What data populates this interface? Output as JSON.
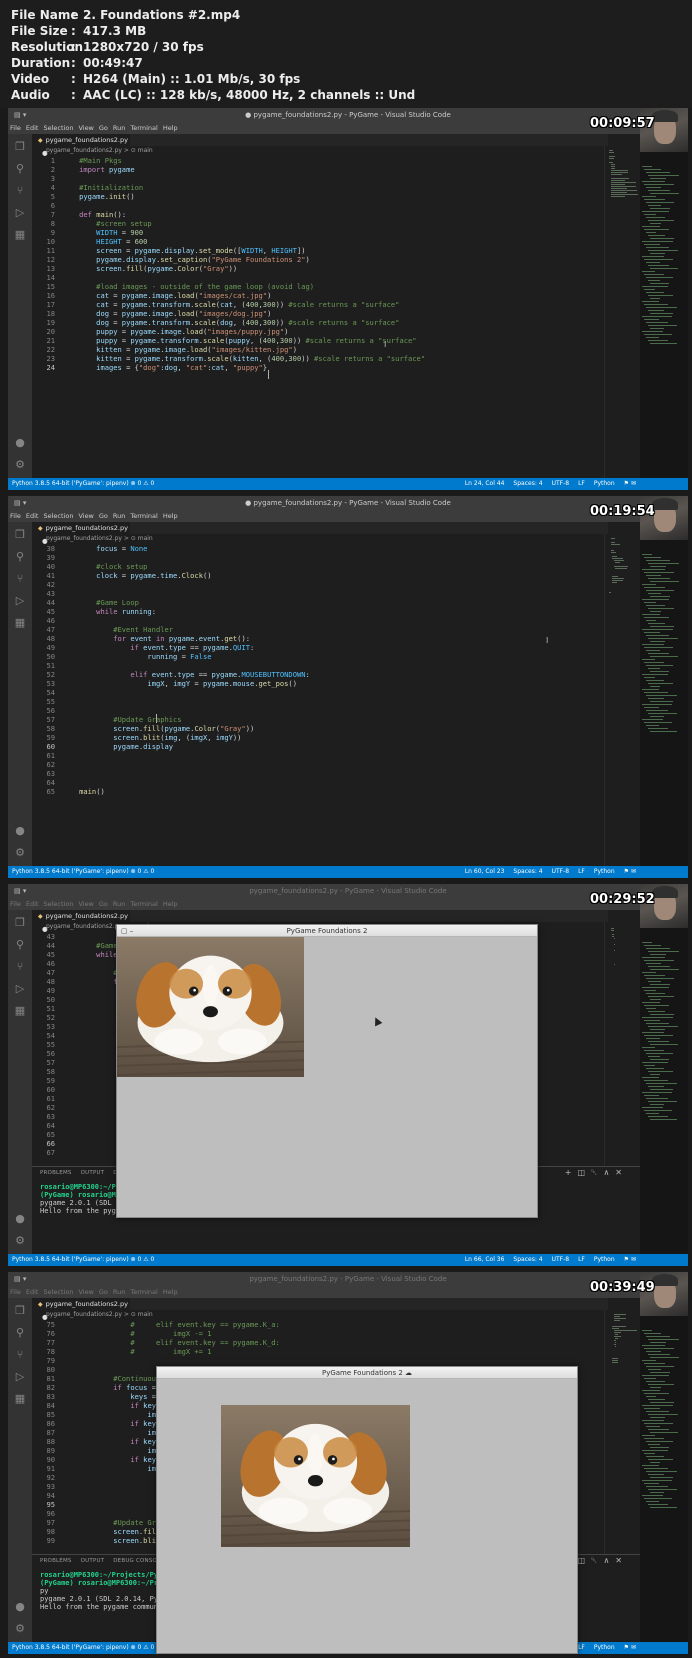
{
  "info": {
    "rows": [
      {
        "key": "File Name",
        "value": "2. Foundations #2.mp4"
      },
      {
        "key": "File Size",
        "value": "417.3 MB"
      },
      {
        "key": "Resolution",
        "value": "1280x720 / 30 fps"
      },
      {
        "key": "Duration",
        "value": "00:49:47"
      },
      {
        "key": "Video",
        "value": "H264 (Main) :: 1.01 Mb/s, 30 fps"
      },
      {
        "key": "Audio",
        "value": "AAC (LC) :: 128 kb/s, 48000 Hz, 2 channels :: Und"
      }
    ]
  },
  "vscode": {
    "menu": [
      "File",
      "Edit",
      "Selection",
      "View",
      "Go",
      "Run",
      "Terminal",
      "Help"
    ],
    "tab_name": "pygame_foundations2.py",
    "breadcrumb": "pygame_foundations2.py > ⊙ main",
    "status_left": "Python 3.8.5 64-bit ('PyGame': pipenv)   ⊗ 0 ⚠ 0",
    "encoding": "UTF-8",
    "eol": "LF",
    "language": "Python",
    "spaces": "Spaces: 4"
  },
  "frames": [
    {
      "title": "● pygame_foundations2.py - PyGame - Visual Studio Code",
      "timestamp": "00:09:57",
      "cursor_pos": "Ln 24, Col 44",
      "lines": [
        {
          "n": "1",
          "code": "    #Main Pkgs"
        },
        {
          "n": "2",
          "code": "    import pygame"
        },
        {
          "n": "3",
          "code": ""
        },
        {
          "n": "4",
          "code": "    #Initialization"
        },
        {
          "n": "5",
          "code": "    pygame.init()"
        },
        {
          "n": "6",
          "code": ""
        },
        {
          "n": "7",
          "code": "    def main():"
        },
        {
          "n": "8",
          "code": "        #screen setup"
        },
        {
          "n": "9",
          "code": "        WIDTH = 900"
        },
        {
          "n": "10",
          "code": "        HEIGHT = 600"
        },
        {
          "n": "11",
          "code": "        screen = pygame.display.set_mode([WIDTH, HEIGHT])"
        },
        {
          "n": "12",
          "code": "        pygame.display.set_caption(\"PyGame Foundations 2\")"
        },
        {
          "n": "13",
          "code": "        screen.fill(pygame.Color(\"Gray\"))"
        },
        {
          "n": "14",
          "code": ""
        },
        {
          "n": "15",
          "code": "        #load images - outside of the game loop (avoid lag)"
        },
        {
          "n": "16",
          "code": "        cat = pygame.image.load(\"images/cat.jpg\")"
        },
        {
          "n": "17",
          "code": "        cat = pygame.transform.scale(cat, (400,300)) #scale returns a \"surface\""
        },
        {
          "n": "18",
          "code": "        dog = pygame.image.load(\"images/dog.jpg\")"
        },
        {
          "n": "19",
          "code": "        dog = pygame.transform.scale(dog, (400,300)) #scale returns a \"surface\""
        },
        {
          "n": "20",
          "code": "        puppy = pygame.image.load(\"images/puppy.jpg\")"
        },
        {
          "n": "21",
          "code": "        puppy = pygame.transform.scale(puppy, (400,300)) #scale returns a \"surface\""
        },
        {
          "n": "22",
          "code": "        kitten = pygame.image.load(\"images/kitten.jpg\")"
        },
        {
          "n": "23",
          "code": "        kitten = pygame.transform.scale(kitten, (400,300)) #scale returns a \"surface\""
        },
        {
          "n": "24",
          "code": "        images = {\"dog\":dog, \"cat\":cat, \"puppy\"}"
        }
      ]
    },
    {
      "title": "● pygame_foundations2.py - PyGame - Visual Studio Code",
      "timestamp": "00:19:54",
      "cursor_pos": "Ln 60, Col 23",
      "lines": [
        {
          "n": "38",
          "code": "        focus = None"
        },
        {
          "n": "39",
          "code": ""
        },
        {
          "n": "40",
          "code": "        #clock setup"
        },
        {
          "n": "41",
          "code": "        clock = pygame.time.Clock()"
        },
        {
          "n": "42",
          "code": ""
        },
        {
          "n": "43",
          "code": ""
        },
        {
          "n": "44",
          "code": "        #Game Loop"
        },
        {
          "n": "45",
          "code": "        while running:"
        },
        {
          "n": "46",
          "code": ""
        },
        {
          "n": "47",
          "code": "            #Event Handler"
        },
        {
          "n": "48",
          "code": "            for event in pygame.event.get():"
        },
        {
          "n": "49",
          "code": "                if event.type == pygame.QUIT:"
        },
        {
          "n": "50",
          "code": "                    running = False"
        },
        {
          "n": "51",
          "code": ""
        },
        {
          "n": "52",
          "code": "                elif event.type == pygame.MOUSEBUTTONDOWN:"
        },
        {
          "n": "53",
          "code": "                    imgX, imgY = pygame.mouse.get_pos()"
        },
        {
          "n": "54",
          "code": ""
        },
        {
          "n": "55",
          "code": ""
        },
        {
          "n": "56",
          "code": ""
        },
        {
          "n": "57",
          "code": "            #Update Graphics"
        },
        {
          "n": "58",
          "code": "            screen.fill(pygame.Color(\"Gray\"))"
        },
        {
          "n": "59",
          "code": "            screen.blit(img, (imgX, imgY))"
        },
        {
          "n": "60",
          "code": "            pygame.display"
        },
        {
          "n": "61",
          "code": ""
        },
        {
          "n": "62",
          "code": ""
        },
        {
          "n": "63",
          "code": ""
        },
        {
          "n": "64",
          "code": ""
        },
        {
          "n": "65",
          "code": "    main()"
        }
      ]
    },
    {
      "title": "pygame_foundations2.py - PyGame - Visual Studio Code",
      "timestamp": "00:29:52",
      "cursor_pos": "Ln 66, Col 36",
      "lines": [
        {
          "n": "43",
          "code": ""
        },
        {
          "n": "44",
          "code": "        #Game Loo"
        },
        {
          "n": "45",
          "code": "        while runn"
        },
        {
          "n": "46",
          "code": ""
        },
        {
          "n": "47",
          "code": "            #Even"
        },
        {
          "n": "48",
          "code": "            for ev"
        },
        {
          "n": "49",
          "code": "                i"
        },
        {
          "n": "50",
          "code": ""
        },
        {
          "n": "51",
          "code": ""
        },
        {
          "n": "52",
          "code": "                e"
        },
        {
          "n": "53",
          "code": ""
        },
        {
          "n": "54",
          "code": ""
        },
        {
          "n": "55",
          "code": "                e"
        },
        {
          "n": "56",
          "code": ""
        },
        {
          "n": "57",
          "code": ""
        },
        {
          "n": "58",
          "code": ""
        },
        {
          "n": "59",
          "code": ""
        },
        {
          "n": "60",
          "code": ""
        },
        {
          "n": "61",
          "code": ""
        },
        {
          "n": "62",
          "code": "                e"
        },
        {
          "n": "63",
          "code": ""
        },
        {
          "n": "64",
          "code": ""
        },
        {
          "n": "65",
          "code": ""
        },
        {
          "n": "66",
          "code": ""
        },
        {
          "n": "67",
          "code": ""
        }
      ],
      "terminal": {
        "tabs": [
          "PROBLEMS",
          "OUTPUT",
          "DEBU"
        ],
        "lines": [
          {
            "a": "rosario@MP6300:~/Proj",
            "b": "",
            "c": "                                                                    ame/pygame_foundations2."
          },
          {
            "a": "(PyGame) rosario@MP630",
            "b": "",
            "c": ""
          },
          {
            "a": "pygame 2.0.1 (SDL 2.0",
            "b": "",
            "c": ""
          },
          {
            "a": "Hello from the pygame",
            "b": "",
            "c": ""
          }
        ]
      },
      "pygame_title": "PyGame Foundations 2"
    },
    {
      "title": "pygame_foundations2.py - PyGame - Visual Studio Code",
      "timestamp": "00:39:49",
      "cursor_pos": "Ln 95, Col 1",
      "lines": [
        {
          "n": "75",
          "code": "                #     elif event.key == pygame.K_a:"
        },
        {
          "n": "76",
          "code": "                #         imgX -= 1"
        },
        {
          "n": "77",
          "code": "                #     elif event.key == pygame.K_d:"
        },
        {
          "n": "78",
          "code": "                #         imgX += 1"
        },
        {
          "n": "79",
          "code": ""
        },
        {
          "n": "80",
          "code": ""
        },
        {
          "n": "81",
          "code": "            #Continuous movement with key held down"
        },
        {
          "n": "82",
          "code": "            if focus == \"image\":"
        },
        {
          "n": "83",
          "code": "                keys = pygame.key.get_pressed() #returns the list of all keys [0,1]"
        },
        {
          "n": "84",
          "code": "                if keys[pygame.K_w]:"
        },
        {
          "n": "85",
          "code": "                    imgY -= 3"
        },
        {
          "n": "86",
          "code": "                if keys[pygame.K_s]:"
        },
        {
          "n": "87",
          "code": "                    imgY += 3"
        },
        {
          "n": "88",
          "code": "                if keys["
        },
        {
          "n": "89",
          "code": "                    img"
        },
        {
          "n": "90",
          "code": "                if keys["
        },
        {
          "n": "91",
          "code": "                    img"
        },
        {
          "n": "92",
          "code": ""
        },
        {
          "n": "93",
          "code": ""
        },
        {
          "n": "94",
          "code": ""
        },
        {
          "n": "95",
          "code": ""
        },
        {
          "n": "96",
          "code": ""
        },
        {
          "n": "97",
          "code": "            #Update Graphics"
        },
        {
          "n": "98",
          "code": "            screen.fill(pyga"
        },
        {
          "n": "99",
          "code": "            screen.blit(img,"
        }
      ],
      "terminal": {
        "tabs": [
          "PROBLEMS",
          "OUTPUT",
          "DEBUG CONSOLE"
        ],
        "lines": [
          {
            "a": "rosario@MP6300:~/Projects/PyGam",
            "b": "",
            "c": "                                                            e_foundations2."
          },
          {
            "a": "(PyGame) rosario@MP6300:~/Proje",
            "b": "",
            "c": ""
          },
          {
            "a": "py",
            "b": "",
            "c": ""
          },
          {
            "a": "pygame 2.0.1 (SDL 2.0.14, Pytho",
            "b": "",
            "c": ""
          },
          {
            "a": "Hello from the pygame community",
            "b": "",
            "c": ""
          }
        ]
      },
      "pygame_title": "PyGame Foundations 2"
    }
  ]
}
